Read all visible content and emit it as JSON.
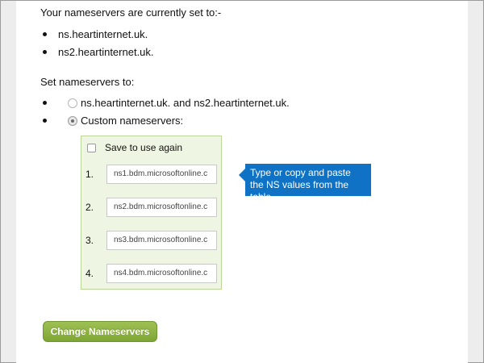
{
  "current": {
    "heading": "Your nameservers are currently set to:-",
    "nameservers": [
      "ns.heartinternet.uk.",
      "ns2.heartinternet.uk."
    ]
  },
  "set": {
    "heading": "Set nameservers to:",
    "option_default_label": "ns.heartinternet.uk. and ns2.heartinternet.uk.",
    "option_custom_label": "Custom nameservers:",
    "selected": "custom"
  },
  "custom": {
    "save_label": "Save to use again",
    "entries": [
      {
        "num": "1.",
        "value": "ns1.bdm.microsoftonline.c"
      },
      {
        "num": "2.",
        "value": "ns2.bdm.microsoftonline.c"
      },
      {
        "num": "3.",
        "value": "ns3.bdm.microsoftonline.c"
      },
      {
        "num": "4.",
        "value": "ns4.bdm.microsoftonline.c"
      }
    ]
  },
  "tooltip": {
    "text": "Type or copy and paste the NS values from the table."
  },
  "actions": {
    "change_label": "Change Nameservers"
  },
  "colors": {
    "accent_green": "#8bb441",
    "tooltip_blue": "#0f72c4",
    "box_bg": "#eef5e2"
  }
}
